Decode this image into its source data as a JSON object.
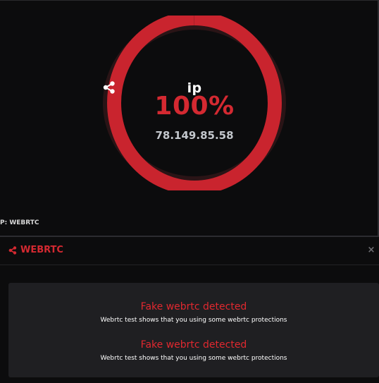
{
  "gauge": {
    "label": "ip",
    "value_text": "100%",
    "progress": 1.0,
    "ip_address": "78.149.85.58",
    "ring_color": "#c9242e",
    "icon": "share-icon"
  },
  "caption": "P: WEBRTC",
  "panel": {
    "title": "WEBRTC",
    "icon": "share-icon",
    "close_symbol": "×"
  },
  "results": [
    {
      "title": "Fake webrtc detected",
      "description": "Webrtc test shows that you using some webrtc protections"
    },
    {
      "title": "Fake webrtc detected",
      "description": "Webrtc test shows that you using some webrtc protections"
    }
  ],
  "colors": {
    "accent": "#d42931",
    "background": "#0c0c0d",
    "card": "#1f1f22"
  }
}
